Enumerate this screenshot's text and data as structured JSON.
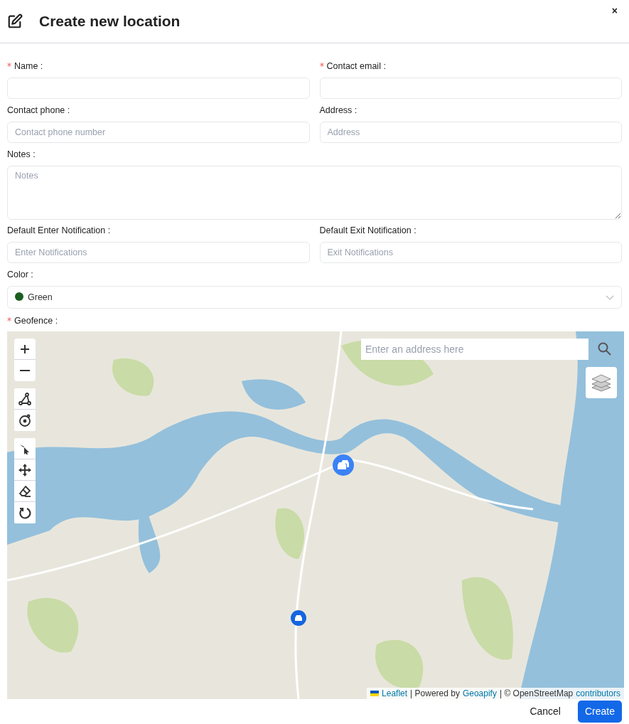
{
  "title": "Create new location",
  "close": "×",
  "fields": [
    {
      "label": "Name :",
      "required": true,
      "kind": "input"
    },
    {
      "label": "Contact email :",
      "required": true,
      "kind": "input"
    },
    {
      "label": "Contact phone :",
      "required": false,
      "kind": "input",
      "placeholder": "Contact phone number"
    },
    {
      "label": "Address :",
      "required": false,
      "kind": "input",
      "placeholder": "Address"
    },
    {
      "label": "Notes :",
      "required": false,
      "kind": "textarea",
      "placeholder": "Notes"
    },
    {
      "label": "Default Enter Notification :",
      "required": false,
      "kind": "input",
      "placeholder": "Enter Notifications"
    },
    {
      "label": "Default Exit Notification :",
      "required": false,
      "kind": "input",
      "placeholder": "Exit Notifications"
    },
    {
      "label": "Color :",
      "required": false,
      "kind": "select",
      "value": "Green",
      "color": "#1b5e20"
    }
  ],
  "geofence": {
    "label": "Geofence :",
    "required": true,
    "search_placeholder": "Enter an address here",
    "attribution": [
      {
        "kind": "link",
        "text": "Leaflet"
      },
      {
        "kind": "text",
        "text": "| Powered by"
      },
      {
        "kind": "link",
        "text": "Geoapify"
      },
      {
        "kind": "text",
        "text": "| © OpenStreetMap"
      },
      {
        "kind": "link",
        "text": "contributors"
      }
    ]
  },
  "buttons": [
    {
      "label": "Cancel",
      "kind": "secondary"
    },
    {
      "label": "Create",
      "kind": "primary"
    }
  ]
}
